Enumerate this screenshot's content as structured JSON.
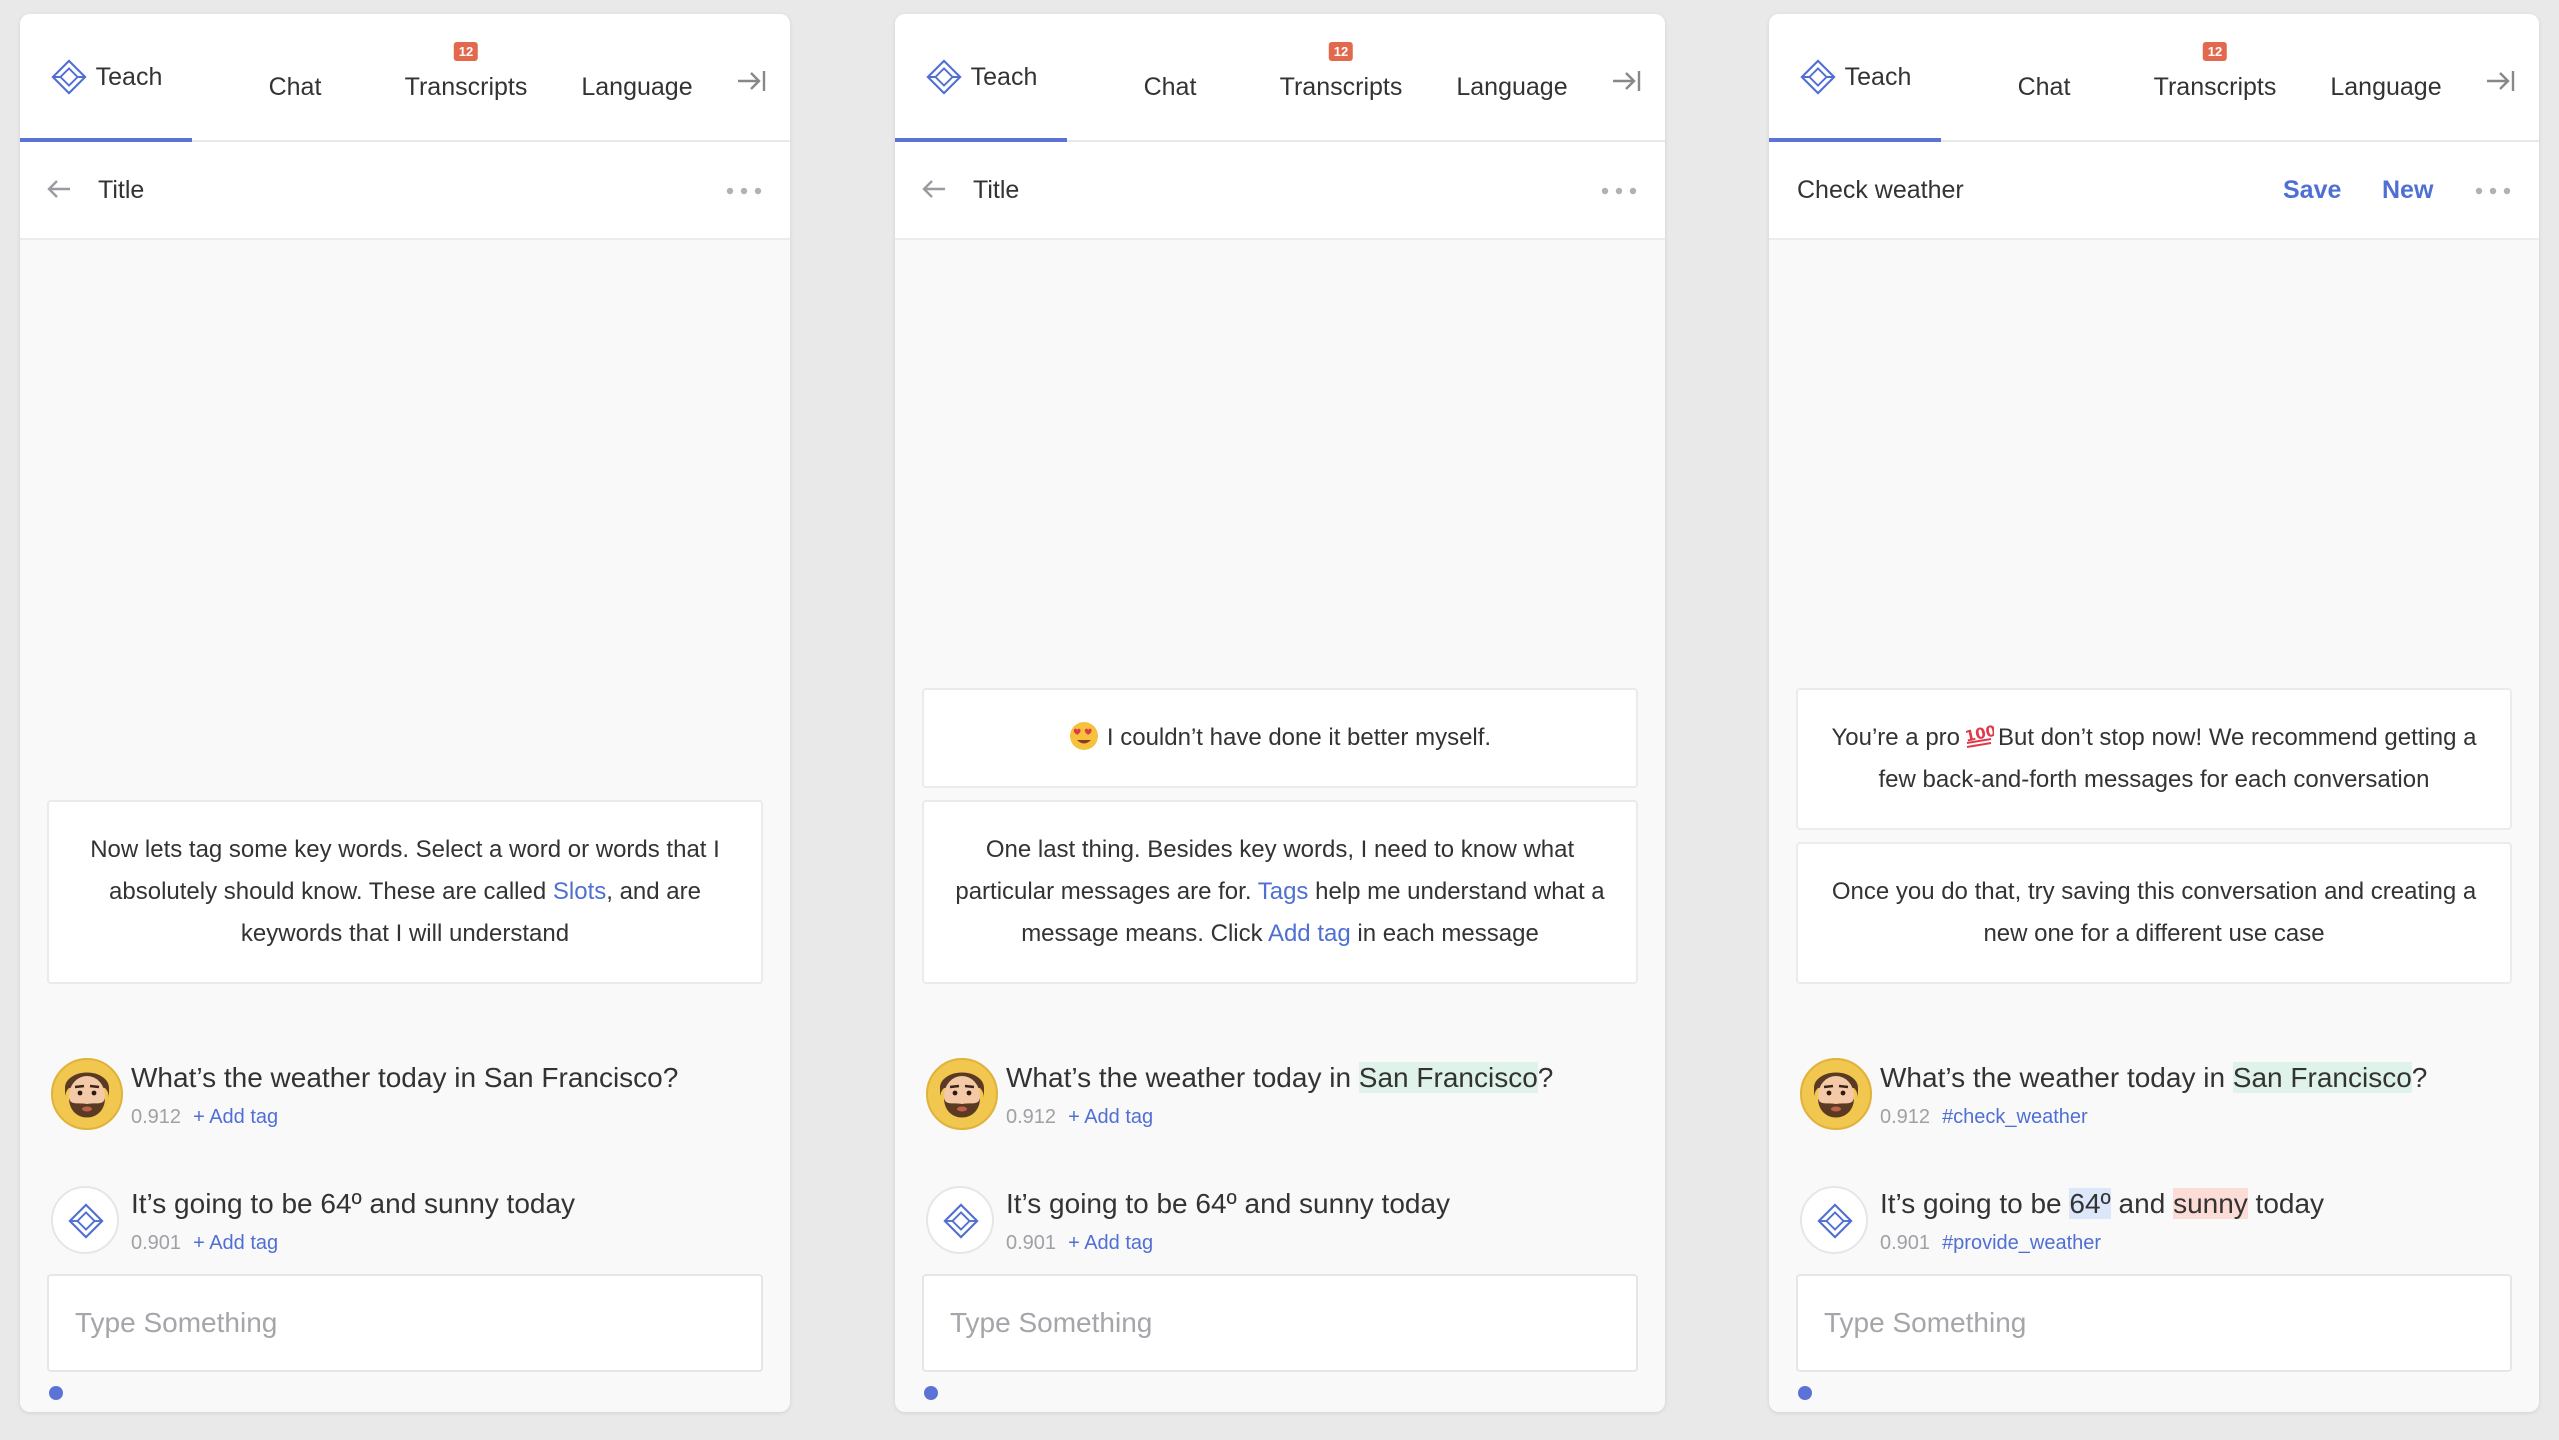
{
  "colors": {
    "accent": "#4f6fd3",
    "badge": "#e3694e",
    "highlight_green": "#dff3ea",
    "highlight_blue": "#dce7fa",
    "highlight_red": "#fbdcd6"
  },
  "icons": {
    "teach": "diamond-icon",
    "collapse": "collapse-right-icon",
    "back": "back-arrow-icon",
    "more": "more-horizontal-icon",
    "bot": "diamond-icon"
  },
  "tabs": {
    "teach": "Teach",
    "chat": "Chat",
    "transcripts": "Transcripts",
    "transcripts_badge": "12",
    "language": "Language"
  },
  "panels": [
    {
      "header": {
        "title": "Title"
      },
      "messages": [
        {
          "parts": [
            "Now lets tag some key words. Select a word or words that I absolutely should know. These are called ",
            "Slots",
            ", and are keywords that I will understand"
          ]
        }
      ],
      "utterances": [
        {
          "text": "What’s the weather today in San Francisco?",
          "score": "0.912",
          "tag": "+ Add tag"
        },
        {
          "text": "It’s going to be 64º and sunny today",
          "score": "0.901",
          "tag": "+ Add tag"
        }
      ],
      "input_placeholder": "Type Something"
    },
    {
      "header": {
        "title": "Title"
      },
      "messages": [
        {
          "text": "I couldn’t have done it better myself."
        },
        {
          "parts": [
            "One last thing. Besides key words, I need to know what particular messages are for. ",
            "Tags",
            " help me understand what a message means. Click ",
            "Add tag",
            " in each message"
          ]
        }
      ],
      "utterances": [
        {
          "parts": [
            "What’s the weather today in ",
            "San Francisco",
            "?"
          ],
          "score": "0.912",
          "tag": "+ Add tag"
        },
        {
          "text": "It’s going to be 64º and sunny today",
          "score": "0.901",
          "tag": "+ Add tag"
        }
      ],
      "input_placeholder": "Type Something"
    },
    {
      "header": {
        "title": "Check weather",
        "save": "Save",
        "new": "New"
      },
      "messages": [
        {
          "parts": [
            "You’re a pro",
            "But don’t stop now! We recommend getting a few back-and-forth messages for each conversation"
          ]
        },
        {
          "text": "Once you do that, try saving this conversation and creating a new one for a different use case"
        }
      ],
      "utterances": [
        {
          "parts": [
            "What’s the weather today in ",
            "San Francisco",
            "?"
          ],
          "score": "0.912",
          "tag": "#check_weather"
        },
        {
          "parts": [
            "It’s going to be ",
            "64º",
            " and ",
            "sunny",
            " today"
          ],
          "score": "0.901",
          "tag": "#provide_weather"
        }
      ],
      "input_placeholder": "Type Something"
    }
  ]
}
